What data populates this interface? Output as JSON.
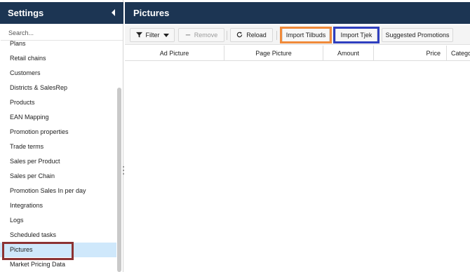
{
  "sidebar": {
    "title": "Settings",
    "search_placeholder": "Search...",
    "items": [
      {
        "label": "Plans"
      },
      {
        "label": "Retail chains"
      },
      {
        "label": "Customers"
      },
      {
        "label": "Districts & SalesRep"
      },
      {
        "label": "Products"
      },
      {
        "label": "EAN Mapping"
      },
      {
        "label": "Promotion properties"
      },
      {
        "label": "Trade terms"
      },
      {
        "label": "Sales per Product"
      },
      {
        "label": "Sales per Chain"
      },
      {
        "label": "Promotion Sales In per day"
      },
      {
        "label": "Integrations"
      },
      {
        "label": "Logs"
      },
      {
        "label": "Scheduled tasks"
      },
      {
        "label": "Pictures",
        "active": true
      },
      {
        "label": "Market Pricing Data"
      }
    ]
  },
  "main": {
    "title": "Pictures",
    "toolbar": {
      "filter_label": "Filter",
      "remove_label": "Remove",
      "reload_label": "Reload",
      "import_tilbuds_label": "Import Tilbuds",
      "import_tjek_label": "Import Tjek",
      "suggested_promotions_label": "Suggested Promotions"
    },
    "columns": [
      "Ad Picture",
      "Page Picture",
      "Amount",
      "Price",
      "Category"
    ]
  },
  "colors": {
    "header_bg": "#1c3553",
    "active_item_bg": "#cfe8fb",
    "highlight_red": "#8c3232",
    "highlight_orange": "#f08a3a",
    "highlight_blue": "#2f3fbf"
  },
  "icons": {
    "collapse": "triangle-left-icon",
    "filter": "filter-icon",
    "remove": "minus-icon",
    "reload": "reload-icon",
    "dropdown": "caret-down-icon"
  }
}
